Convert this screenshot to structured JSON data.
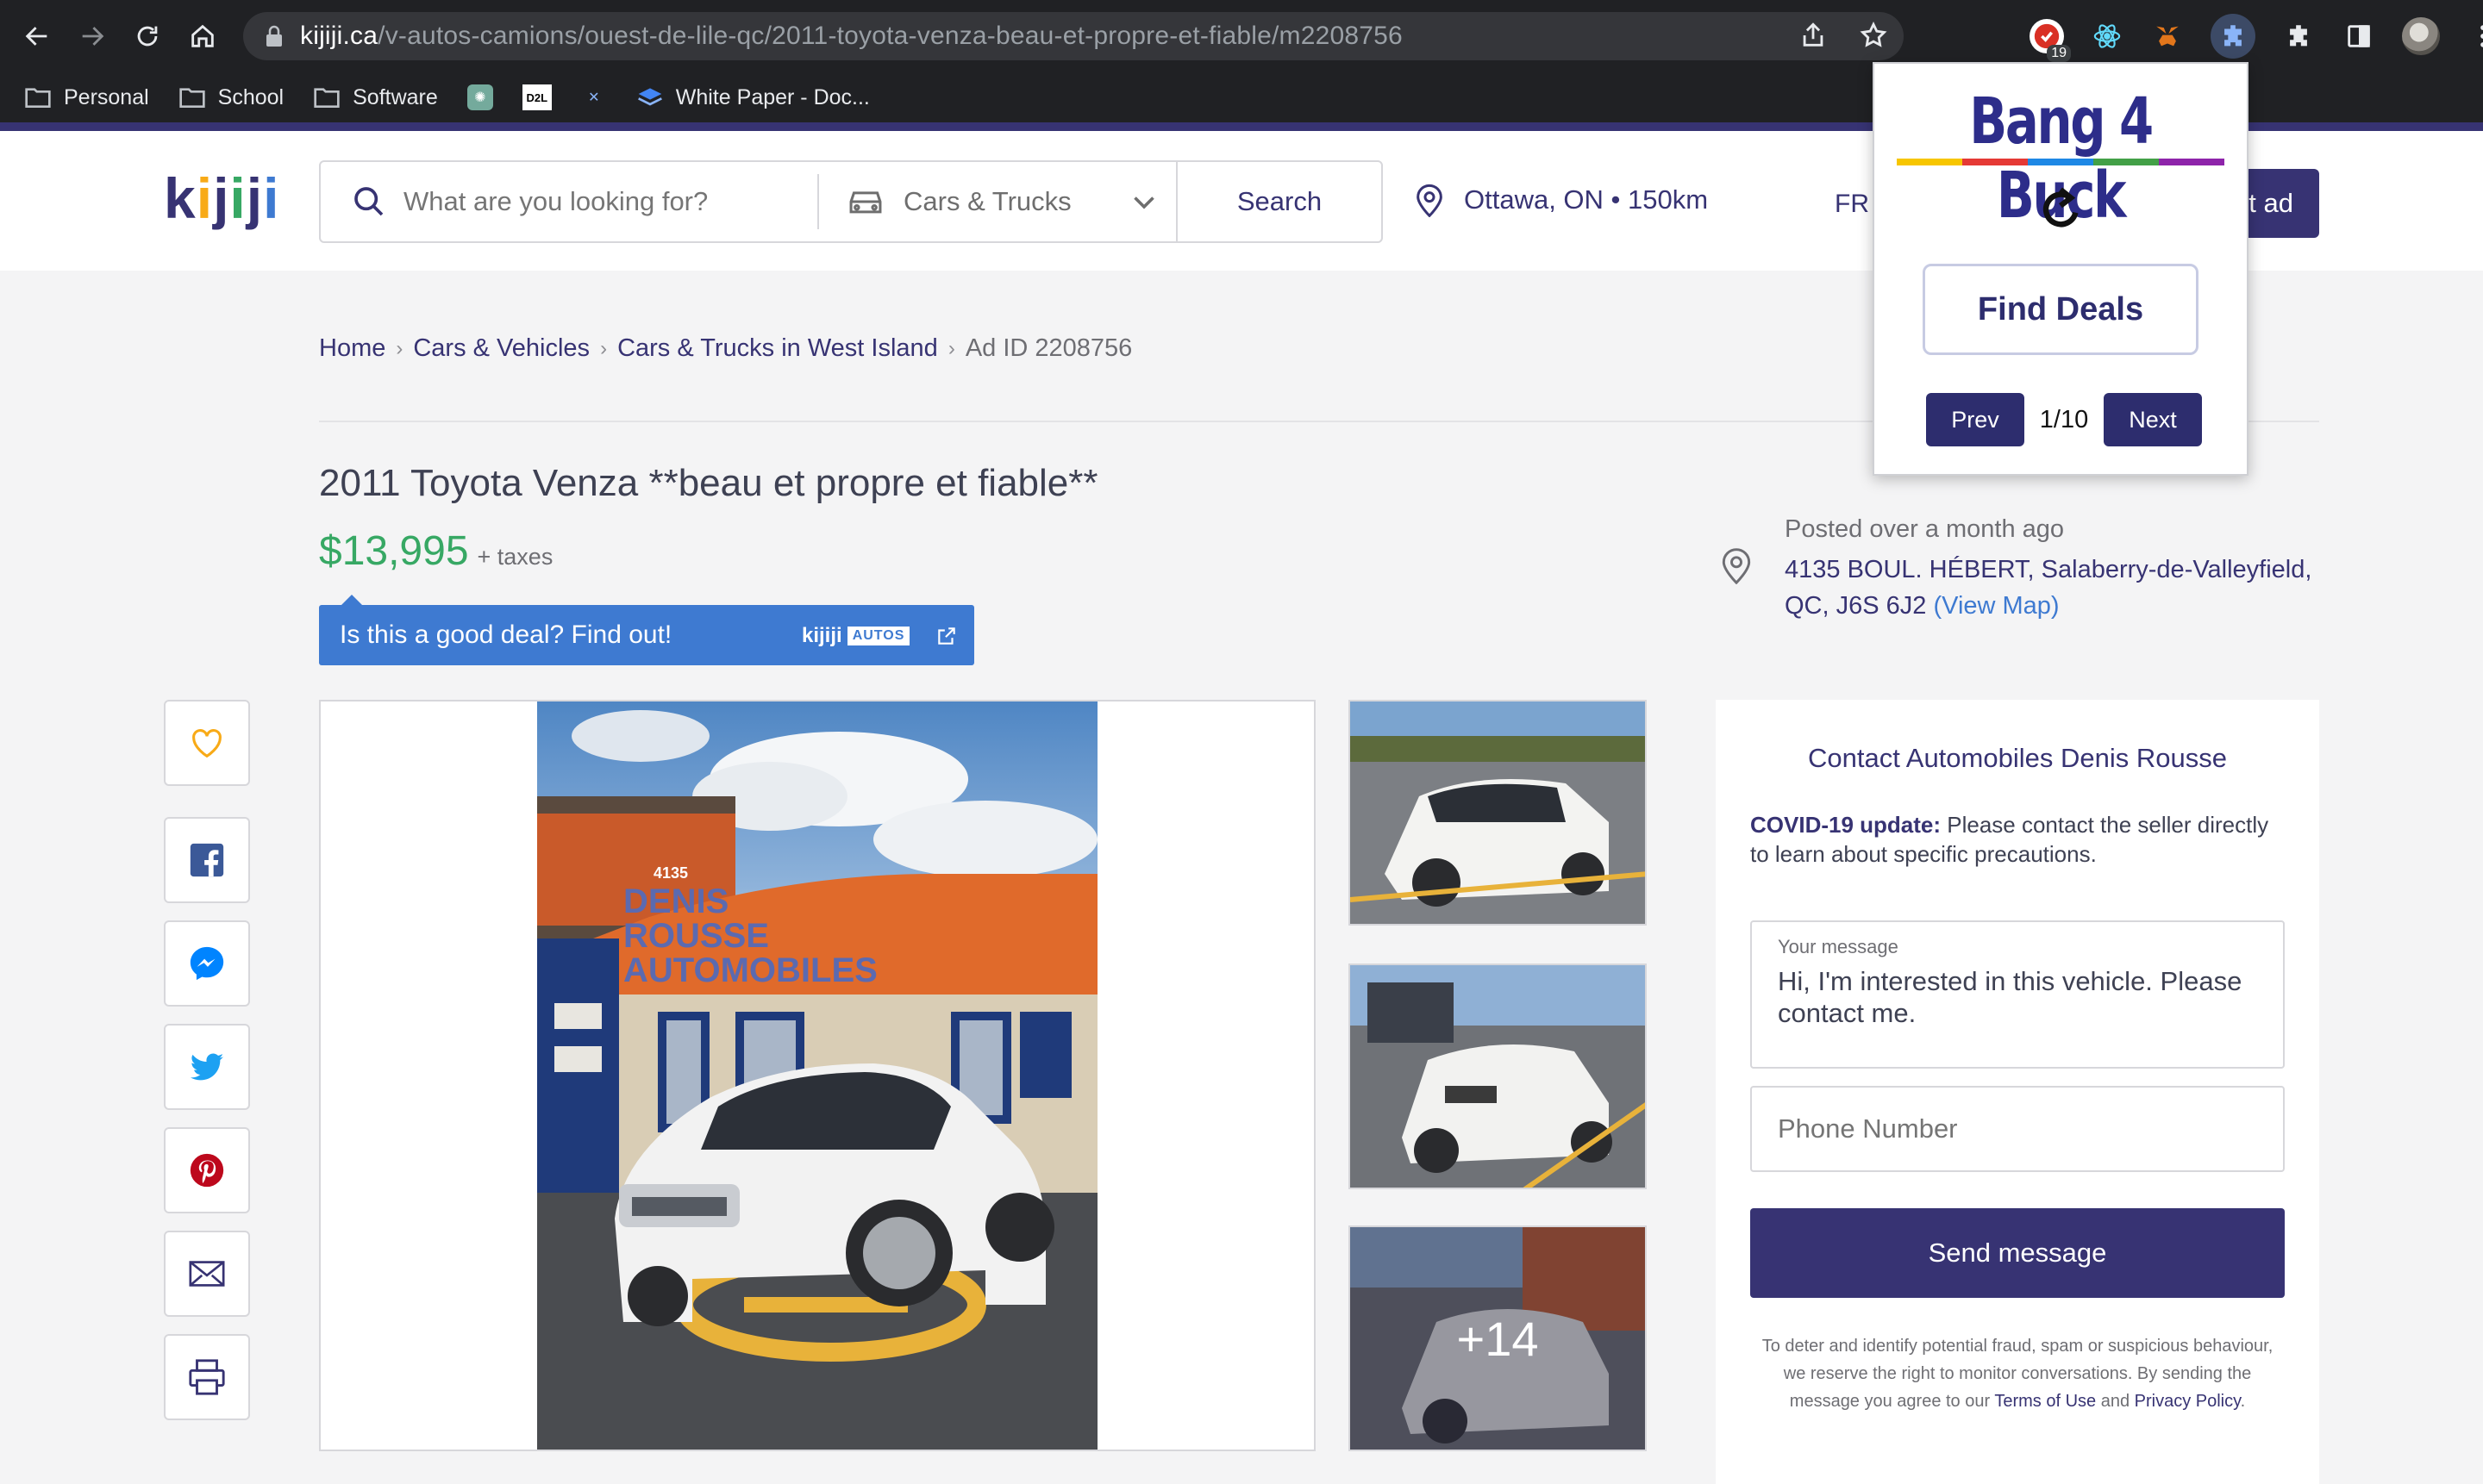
{
  "browser": {
    "url_host": "kijiji.ca",
    "url_path": "/v-autos-camions/ouest-de-lile-qc/2011-toyota-venza-beau-et-propre-et-fiable/m2208756",
    "extension_badge": "19",
    "bookmarks": [
      "Personal",
      "School",
      "Software",
      "White Paper - Doc..."
    ],
    "bookmark_icon_label": "D2L"
  },
  "header": {
    "logo": [
      "k",
      "i",
      "j",
      "i",
      "j",
      "i"
    ],
    "logo_colors": [
      "#373373",
      "#f8aa17",
      "#373373",
      "#37a864",
      "#373373",
      "#3e7ad1"
    ],
    "search_placeholder": "What are you looking for?",
    "category": "Cars & Trucks",
    "search_label": "Search",
    "location": "Ottawa, ON • 150km",
    "lang": "FR",
    "post_ad_visible": "t ad"
  },
  "breadcrumb": [
    "Home",
    "Cars & Vehicles",
    "Cars & Trucks in West Island",
    "Ad ID 2208756"
  ],
  "listing": {
    "title": "2011 Toyota Venza **beau et propre et fiable**",
    "price": "$13,995",
    "price_suffix": "+ taxes",
    "deal_text": "Is this a good deal? Find out!",
    "deal_brand": "kijiji",
    "deal_brand_tag": "AUTOS",
    "posted": "Posted over a month ago",
    "address": "4135 BOUL. HÉBERT, Salaberry-de-Valleyfield, QC, J6S 6J2",
    "view_map": "(View Map)",
    "more_photos": "+14",
    "photo_sign_number": "4135",
    "photo_sign_lines": [
      "DENIS",
      "ROUSSE",
      "AUTOMOBILES"
    ]
  },
  "share": [
    "favourite-icon",
    "facebook-icon",
    "messenger-icon",
    "twitter-icon",
    "pinterest-icon",
    "email-icon",
    "print-icon"
  ],
  "contact": {
    "heading": "Contact Automobiles Denis Rousse",
    "covid_label": "COVID-19 update:",
    "covid_text": " Please contact the seller directly to learn about specific precautions.",
    "message_label": "Your message",
    "message_text": "Hi, I'm interested in this vehicle. Please contact me.",
    "phone_placeholder": "Phone Number",
    "send_label": "Send message",
    "fine_a": "To deter and identify potential fraud, spam or suspicious behaviour, we reserve the right to monitor conversations. By sending the message you agree to our ",
    "fine_terms": "Terms of Use",
    "fine_and": " and ",
    "fine_privacy": "Privacy Policy",
    "fine_end": "."
  },
  "extension": {
    "title": "Bang 4 Buck",
    "find_label": "Find Deals",
    "prev_label": "Prev",
    "count": "1/10",
    "next_label": "Next"
  }
}
